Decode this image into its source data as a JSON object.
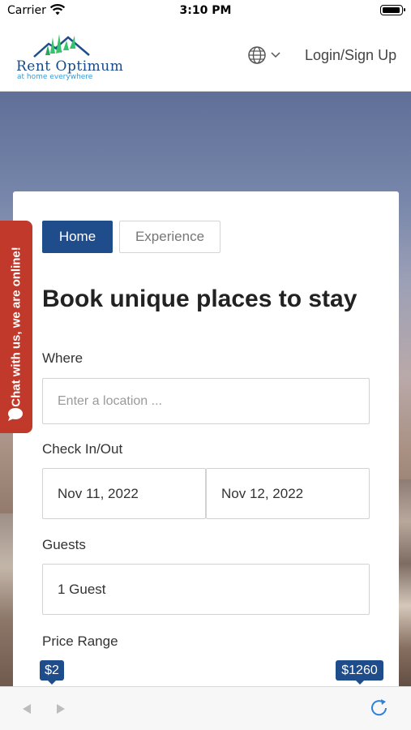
{
  "status": {
    "carrier": "Carrier",
    "time": "3:10 PM"
  },
  "header": {
    "logo_name": "Rent Optimum",
    "logo_tagline": "at home everywhere",
    "login_label": "Login/Sign Up",
    "icons": [
      "globe-icon",
      "chevron-down-icon"
    ]
  },
  "chat": {
    "label": "Chat with us, we are online!",
    "icon": "chat-bubble-icon",
    "color": "#c0392b"
  },
  "search": {
    "tabs": [
      {
        "label": "Home",
        "active": true
      },
      {
        "label": "Experience",
        "active": false
      }
    ],
    "title": "Book unique places to stay",
    "where_label": "Where",
    "where_placeholder": "Enter a location ...",
    "checkinout_label": "Check In/Out",
    "check_in": "Nov 11, 2022",
    "check_out": "Nov 12, 2022",
    "guests_label": "Guests",
    "guests_value": "1 Guest",
    "price_label": "Price Range",
    "price_min": "$2",
    "price_max": "$1260"
  },
  "colors": {
    "brand": "#1f4d8b",
    "logo_green": "#35c46b",
    "chat_red": "#c0392b"
  },
  "toolbar": {
    "icons": [
      "back-arrow-icon",
      "forward-arrow-icon",
      "reload-icon"
    ]
  }
}
